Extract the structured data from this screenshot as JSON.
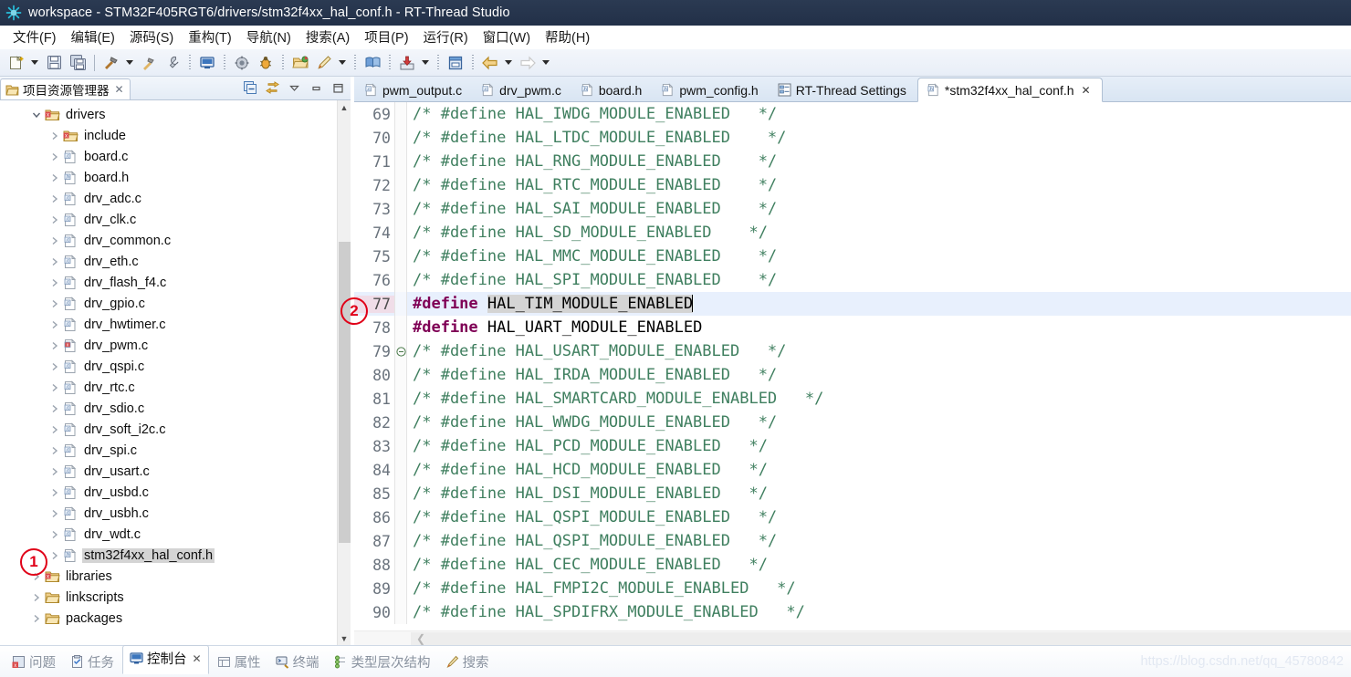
{
  "window": {
    "title": "workspace - STM32F405RGT6/drivers/stm32f4xx_hal_conf.h - RT-Thread Studio",
    "app_icon": "rtthread-logo-icon"
  },
  "menubar": {
    "items": [
      {
        "label": "文件(F)",
        "mnemonic": "F"
      },
      {
        "label": "编辑(E)",
        "mnemonic": "E"
      },
      {
        "label": "源码(S)",
        "mnemonic": "S"
      },
      {
        "label": "重构(T)",
        "mnemonic": "T"
      },
      {
        "label": "导航(N)",
        "mnemonic": "N"
      },
      {
        "label": "搜索(A)",
        "mnemonic": "A"
      },
      {
        "label": "项目(P)",
        "mnemonic": "P"
      },
      {
        "label": "运行(R)",
        "mnemonic": "R"
      },
      {
        "label": "窗口(W)",
        "mnemonic": "W"
      },
      {
        "label": "帮助(H)",
        "mnemonic": "H"
      }
    ]
  },
  "toolbar": {
    "items": [
      {
        "name": "new-file-button",
        "icon": "new-file-icon"
      },
      {
        "name": "new-file-dropdown",
        "icon": "chevron-down-icon"
      },
      {
        "name": "save-button",
        "icon": "save-icon"
      },
      {
        "name": "save-all-button",
        "icon": "save-all-icon"
      },
      {
        "name": "separator-1",
        "icon": "separator"
      },
      {
        "name": "build-button",
        "icon": "hammer-icon"
      },
      {
        "name": "build-dropdown",
        "icon": "chevron-down-icon"
      },
      {
        "name": "clean-button",
        "icon": "clean-hammer-icon"
      },
      {
        "name": "settings-button",
        "icon": "wrench-icon"
      },
      {
        "name": "separator-2",
        "icon": "dot-separator"
      },
      {
        "name": "terminal-button",
        "icon": "monitor-icon"
      },
      {
        "name": "separator-3",
        "icon": "dot-separator"
      },
      {
        "name": "flash-download-button",
        "icon": "gear-icon"
      },
      {
        "name": "debug-button",
        "icon": "bug-icon"
      },
      {
        "name": "separator-4",
        "icon": "dot-separator"
      },
      {
        "name": "open-resource-button",
        "icon": "open-folder-icon"
      },
      {
        "name": "pen-button",
        "icon": "pen-icon"
      },
      {
        "name": "pen-dropdown",
        "icon": "chevron-down-icon"
      },
      {
        "name": "separator-5",
        "icon": "dot-separator"
      },
      {
        "name": "help-book-button",
        "icon": "book-icon"
      },
      {
        "name": "separator-6",
        "icon": "dot-separator"
      },
      {
        "name": "import-button",
        "icon": "import-icon"
      },
      {
        "name": "import-dropdown",
        "icon": "chevron-down-icon"
      },
      {
        "name": "separator-7",
        "icon": "dot-separator"
      },
      {
        "name": "package-manager-button",
        "icon": "drawer-icon"
      },
      {
        "name": "separator-8",
        "icon": "dot-separator"
      },
      {
        "name": "back-button",
        "icon": "arrow-left-icon"
      },
      {
        "name": "back-dropdown",
        "icon": "chevron-down-icon"
      },
      {
        "name": "forward-button",
        "icon": "arrow-right-icon"
      },
      {
        "name": "forward-dropdown",
        "icon": "chevron-down-icon"
      }
    ]
  },
  "explorer": {
    "tab_label": "项目资源管理器",
    "tab_icon": "project-explorer-icon",
    "tools": [
      {
        "name": "collapse-all-button",
        "icon": "collapse-all-icon"
      },
      {
        "name": "link-with-editor-button",
        "icon": "link-editor-icon"
      },
      {
        "name": "view-menu-button",
        "icon": "chevron-down-icon"
      },
      {
        "name": "minimize-view-button",
        "icon": "minimize-icon"
      },
      {
        "name": "maximize-view-button",
        "icon": "maximize-icon"
      }
    ],
    "tree": [
      {
        "label": "drivers",
        "type": "folder-project",
        "indent": 1,
        "expanded": true,
        "selected": false
      },
      {
        "label": "include",
        "type": "folder-project",
        "indent": 2,
        "expanded": false,
        "selected": false
      },
      {
        "label": "board.c",
        "type": "c-file",
        "indent": 2,
        "expanded": false,
        "selected": false
      },
      {
        "label": "board.h",
        "type": "h-file",
        "indent": 2,
        "expanded": false,
        "selected": false
      },
      {
        "label": "drv_adc.c",
        "type": "c-file",
        "indent": 2,
        "expanded": false,
        "selected": false
      },
      {
        "label": "drv_clk.c",
        "type": "c-file",
        "indent": 2,
        "expanded": false,
        "selected": false
      },
      {
        "label": "drv_common.c",
        "type": "c-file",
        "indent": 2,
        "expanded": false,
        "selected": false
      },
      {
        "label": "drv_eth.c",
        "type": "c-file",
        "indent": 2,
        "expanded": false,
        "selected": false
      },
      {
        "label": "drv_flash_f4.c",
        "type": "c-file",
        "indent": 2,
        "expanded": false,
        "selected": false
      },
      {
        "label": "drv_gpio.c",
        "type": "c-file",
        "indent": 2,
        "expanded": false,
        "selected": false
      },
      {
        "label": "drv_hwtimer.c",
        "type": "c-file",
        "indent": 2,
        "expanded": false,
        "selected": false
      },
      {
        "label": "drv_pwm.c",
        "type": "c-file-error",
        "indent": 2,
        "expanded": false,
        "selected": false
      },
      {
        "label": "drv_qspi.c",
        "type": "c-file",
        "indent": 2,
        "expanded": false,
        "selected": false
      },
      {
        "label": "drv_rtc.c",
        "type": "c-file",
        "indent": 2,
        "expanded": false,
        "selected": false
      },
      {
        "label": "drv_sdio.c",
        "type": "c-file",
        "indent": 2,
        "expanded": false,
        "selected": false
      },
      {
        "label": "drv_soft_i2c.c",
        "type": "c-file",
        "indent": 2,
        "expanded": false,
        "selected": false
      },
      {
        "label": "drv_spi.c",
        "type": "c-file",
        "indent": 2,
        "expanded": false,
        "selected": false
      },
      {
        "label": "drv_usart.c",
        "type": "c-file",
        "indent": 2,
        "expanded": false,
        "selected": false
      },
      {
        "label": "drv_usbd.c",
        "type": "c-file",
        "indent": 2,
        "expanded": false,
        "selected": false
      },
      {
        "label": "drv_usbh.c",
        "type": "c-file",
        "indent": 2,
        "expanded": false,
        "selected": false
      },
      {
        "label": "drv_wdt.c",
        "type": "c-file",
        "indent": 2,
        "expanded": false,
        "selected": false
      },
      {
        "label": "stm32f4xx_hal_conf.h",
        "type": "h-file",
        "indent": 2,
        "expanded": false,
        "selected": true
      },
      {
        "label": "libraries",
        "type": "folder-project",
        "indent": 1,
        "expanded": false,
        "selected": false
      },
      {
        "label": "linkscripts",
        "type": "folder",
        "indent": 1,
        "expanded": false,
        "selected": false
      },
      {
        "label": "packages",
        "type": "folder",
        "indent": 1,
        "expanded": false,
        "selected": false
      }
    ]
  },
  "editor": {
    "tabs": [
      {
        "label": "pwm_output.c",
        "icon": "c-file-icon",
        "active": false,
        "dirty": false
      },
      {
        "label": "drv_pwm.c",
        "icon": "c-file-icon",
        "active": false,
        "dirty": false
      },
      {
        "label": "board.h",
        "icon": "h-file-icon",
        "active": false,
        "dirty": false
      },
      {
        "label": "pwm_config.h",
        "icon": "h-file-icon",
        "active": false,
        "dirty": false
      },
      {
        "label": "RT-Thread Settings",
        "icon": "settings-file-icon",
        "active": false,
        "dirty": false
      },
      {
        "label": "*stm32f4xx_hal_conf.h",
        "icon": "h-file-icon",
        "active": true,
        "dirty": true
      }
    ],
    "lines": [
      {
        "num": "69",
        "kind": "comment",
        "text": "/* #define HAL_IWDG_MODULE_ENABLED   */",
        "fold": ""
      },
      {
        "num": "70",
        "kind": "comment",
        "text": "/* #define HAL_LTDC_MODULE_ENABLED    */",
        "fold": ""
      },
      {
        "num": "71",
        "kind": "comment",
        "text": "/* #define HAL_RNG_MODULE_ENABLED    */",
        "fold": ""
      },
      {
        "num": "72",
        "kind": "comment",
        "text": "/* #define HAL_RTC_MODULE_ENABLED    */",
        "fold": ""
      },
      {
        "num": "73",
        "kind": "comment",
        "text": "/* #define HAL_SAI_MODULE_ENABLED    */",
        "fold": ""
      },
      {
        "num": "74",
        "kind": "comment",
        "text": "/* #define HAL_SD_MODULE_ENABLED    */",
        "fold": ""
      },
      {
        "num": "75",
        "kind": "comment",
        "text": "/* #define HAL_MMC_MODULE_ENABLED    */",
        "fold": ""
      },
      {
        "num": "76",
        "kind": "comment",
        "text": "/* #define HAL_SPI_MODULE_ENABLED    */",
        "fold": ""
      },
      {
        "num": "77",
        "kind": "define-selected",
        "keyword": "#define",
        "identifier": "HAL_TIM_MODULE_ENABLED",
        "fold": ""
      },
      {
        "num": "78",
        "kind": "define",
        "keyword": "#define",
        "identifier": "HAL_UART_MODULE_ENABLED",
        "fold": ""
      },
      {
        "num": "79",
        "kind": "comment",
        "text": "/* #define HAL_USART_MODULE_ENABLED   */",
        "fold": "collapse"
      },
      {
        "num": "80",
        "kind": "comment",
        "text": "/* #define HAL_IRDA_MODULE_ENABLED   */",
        "fold": ""
      },
      {
        "num": "81",
        "kind": "comment",
        "text": "/* #define HAL_SMARTCARD_MODULE_ENABLED   */",
        "fold": ""
      },
      {
        "num": "82",
        "kind": "comment",
        "text": "/* #define HAL_WWDG_MODULE_ENABLED   */",
        "fold": ""
      },
      {
        "num": "83",
        "kind": "comment",
        "text": "/* #define HAL_PCD_MODULE_ENABLED   */",
        "fold": ""
      },
      {
        "num": "84",
        "kind": "comment",
        "text": "/* #define HAL_HCD_MODULE_ENABLED   */",
        "fold": ""
      },
      {
        "num": "85",
        "kind": "comment",
        "text": "/* #define HAL_DSI_MODULE_ENABLED   */",
        "fold": ""
      },
      {
        "num": "86",
        "kind": "comment",
        "text": "/* #define HAL_QSPI_MODULE_ENABLED   */",
        "fold": ""
      },
      {
        "num": "87",
        "kind": "comment",
        "text": "/* #define HAL_QSPI_MODULE_ENABLED   */",
        "fold": ""
      },
      {
        "num": "88",
        "kind": "comment",
        "text": "/* #define HAL_CEC_MODULE_ENABLED   */",
        "fold": ""
      },
      {
        "num": "89",
        "kind": "comment",
        "text": "/* #define HAL_FMPI2C_MODULE_ENABLED   */",
        "fold": ""
      },
      {
        "num": "90",
        "kind": "comment",
        "text": "/* #define HAL_SPDIFRX_MODULE_ENABLED   */",
        "fold": ""
      }
    ]
  },
  "bottom_tabs": [
    {
      "label": "问题",
      "icon": "problems-icon",
      "active": false
    },
    {
      "label": "任务",
      "icon": "tasks-icon",
      "active": false
    },
    {
      "label": "控制台",
      "icon": "console-icon",
      "active": true
    },
    {
      "label": "属性",
      "icon": "properties-icon",
      "active": false
    },
    {
      "label": "终端",
      "icon": "terminal-icon",
      "active": false
    },
    {
      "label": "类型层次结构",
      "icon": "type-hierarchy-icon",
      "active": false
    },
    {
      "label": "搜索",
      "icon": "search-icon",
      "active": false
    }
  ],
  "watermark": "https://blog.csdn.net/qq_45780842",
  "annotations": [
    {
      "id": "1",
      "target": "stm32f4xx_hal_conf.h"
    },
    {
      "id": "2",
      "target": "line-77"
    }
  ],
  "colors": {
    "titlebar": "#283751",
    "accent_red": "#e00018",
    "comment_green": "#3f7f5f",
    "keyword_purple": "#7f0055",
    "highlight_line": "#e8f0fd",
    "gutter_highlight": "#f0dde8",
    "selection_gray": "#d4d4d4"
  }
}
